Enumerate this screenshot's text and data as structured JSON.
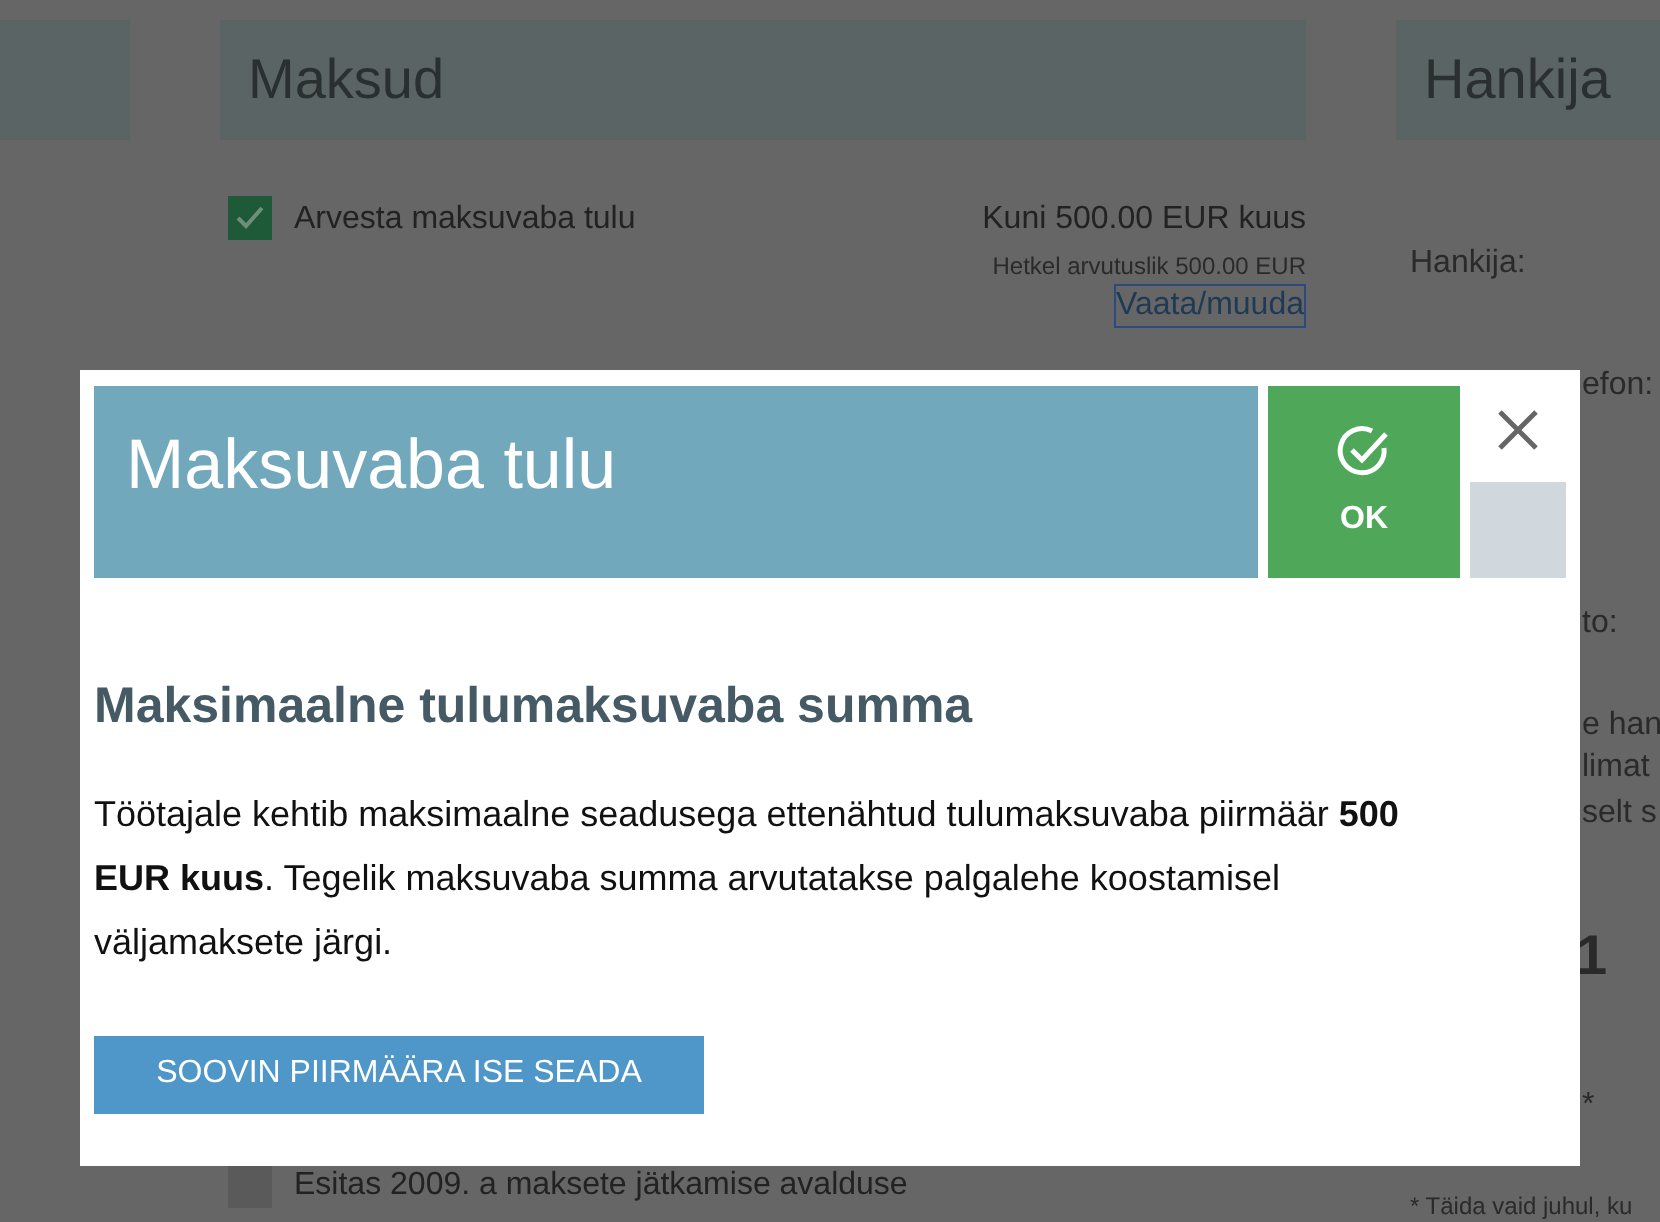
{
  "taxes": {
    "title": "Maksud",
    "items": [
      {
        "label": "Arvesta maksuvaba tulu",
        "checked": true,
        "amount": "Kuni 500.00 EUR kuus",
        "note": "Hetkel arvutuslik 500.00 EUR",
        "link": "Vaata/muuda"
      },
      {
        "label": "Esitas 2009. a maksete jätkamise avalduse",
        "checked": false
      }
    ]
  },
  "supplier": {
    "title": "Hankija",
    "texts": [
      {
        "kind": "label",
        "text": "Hankija:"
      },
      {
        "kind": "fragment",
        "text": "efon:"
      },
      {
        "kind": "fragment",
        "text": "to:"
      },
      {
        "kind": "fragment",
        "text": "e han"
      },
      {
        "kind": "fragment",
        "text": "limat"
      },
      {
        "kind": "fragment",
        "text": "selt s"
      },
      {
        "kind": "big",
        "text": "1"
      },
      {
        "kind": "fragment",
        "text": "*"
      },
      {
        "kind": "footnote",
        "text": "* Täida vaid juhul, ku"
      }
    ]
  },
  "dialog": {
    "title": "Maksuvaba tulu",
    "ok_label": "OK",
    "heading": "Maksimaalne tulumaksuvaba summa",
    "paragraph": "Töötajale kehtib maksimaalne seadusega ettenähtud tulumaksuvaba piirmäär **500 EUR kuus**. Tegelik maksuvaba summa arvutatakse palgalehe koostamisel väljamaksete järgi.",
    "button": "SOOVIN PIIRMÄÄRA ISE SEADA"
  }
}
